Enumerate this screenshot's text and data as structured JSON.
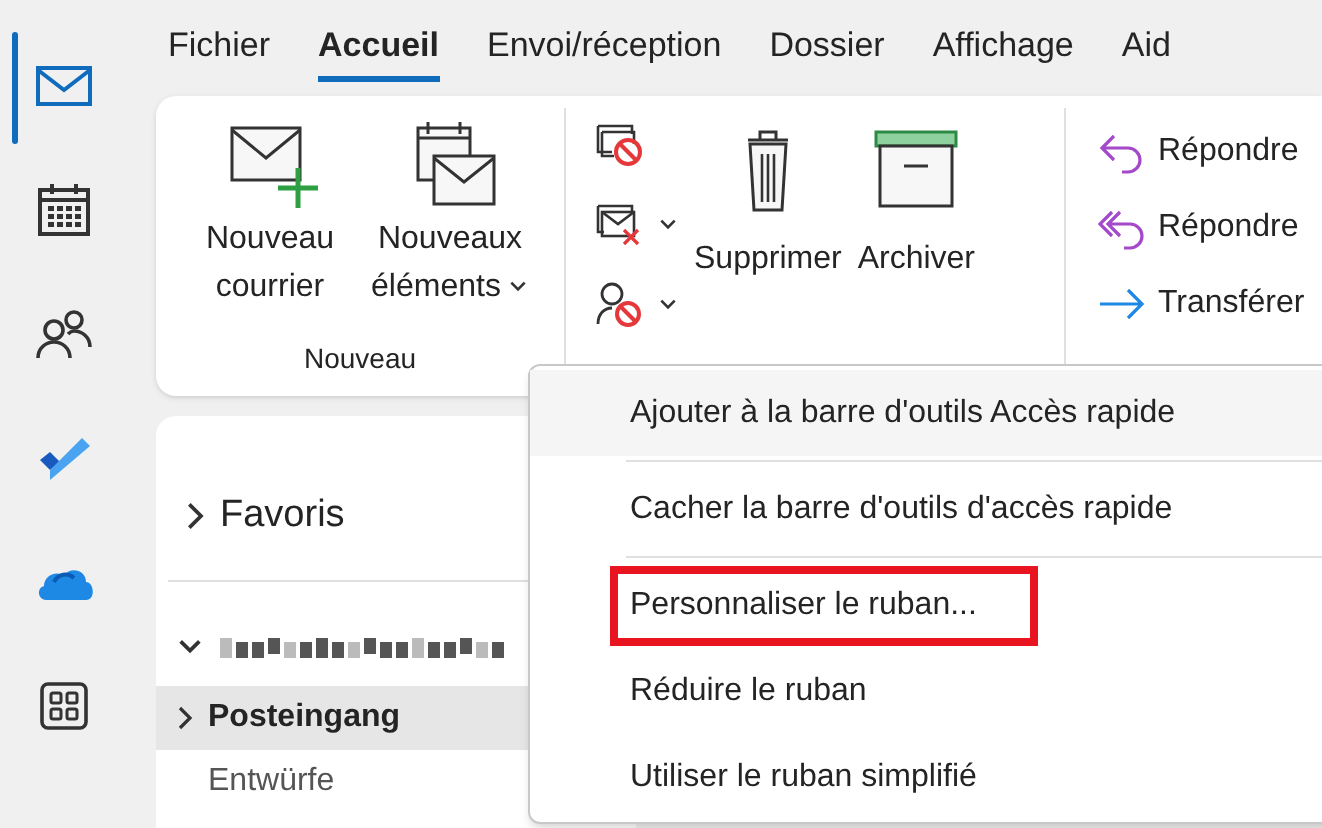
{
  "nav_rail": [
    {
      "kind": "mail",
      "selected": true
    },
    {
      "kind": "calendar",
      "selected": false
    },
    {
      "kind": "people",
      "selected": false
    },
    {
      "kind": "todo",
      "selected": false
    },
    {
      "kind": "cloud",
      "selected": false
    },
    {
      "kind": "apps",
      "selected": false
    }
  ],
  "tabs": [
    {
      "label": "Fichier",
      "selected": false
    },
    {
      "label": "Accueil",
      "selected": true
    },
    {
      "label": "Envoi/réception",
      "selected": false
    },
    {
      "label": "Dossier",
      "selected": false
    },
    {
      "label": "Affichage",
      "selected": false
    },
    {
      "label": "Aid",
      "selected": false
    }
  ],
  "ribbon": {
    "new_group": {
      "label": "Nouveau",
      "buttons": [
        {
          "kind": "new-mail",
          "label": "Nouveau courrier",
          "dropdown": false
        },
        {
          "kind": "new-items",
          "label": "Nouveaux éléments",
          "dropdown": true
        }
      ]
    },
    "delete_group": {
      "small_buttons": [
        {
          "kind": "ignore",
          "dropdown": false
        },
        {
          "kind": "junk",
          "dropdown": true
        },
        {
          "kind": "block",
          "dropdown": true
        }
      ],
      "buttons": [
        {
          "kind": "delete",
          "label": "Supprimer"
        },
        {
          "kind": "archive",
          "label": "Archiver"
        }
      ]
    },
    "respond_group": {
      "buttons": [
        {
          "kind": "reply",
          "label": "Répondre"
        },
        {
          "kind": "reply-all",
          "label": "Répondre"
        },
        {
          "kind": "forward",
          "label": "Transférer"
        }
      ]
    }
  },
  "folder_pane": {
    "favorites": {
      "label": "Favoris",
      "expanded": false
    },
    "account": {
      "expanded": true,
      "folders": [
        {
          "label": "Posteingang",
          "selected": true,
          "expandable": true
        },
        {
          "label": "Entwürfe",
          "selected": false,
          "expandable": false
        }
      ]
    }
  },
  "context_menu": [
    {
      "label": "Ajouter à la barre d'outils Accès rapide",
      "hovered": true,
      "outlined": false,
      "separator_after": true
    },
    {
      "label": "Cacher la barre d'outils d'accès rapide",
      "hovered": false,
      "outlined": false,
      "separator_after": true
    },
    {
      "label": "Personnaliser le ruban...",
      "hovered": false,
      "outlined": true,
      "separator_after": false
    },
    {
      "label": "Réduire le ruban",
      "hovered": false,
      "outlined": false,
      "separator_after": false
    },
    {
      "label": "Utiliser le ruban simplifié",
      "hovered": false,
      "outlined": false,
      "separator_after": false
    }
  ]
}
